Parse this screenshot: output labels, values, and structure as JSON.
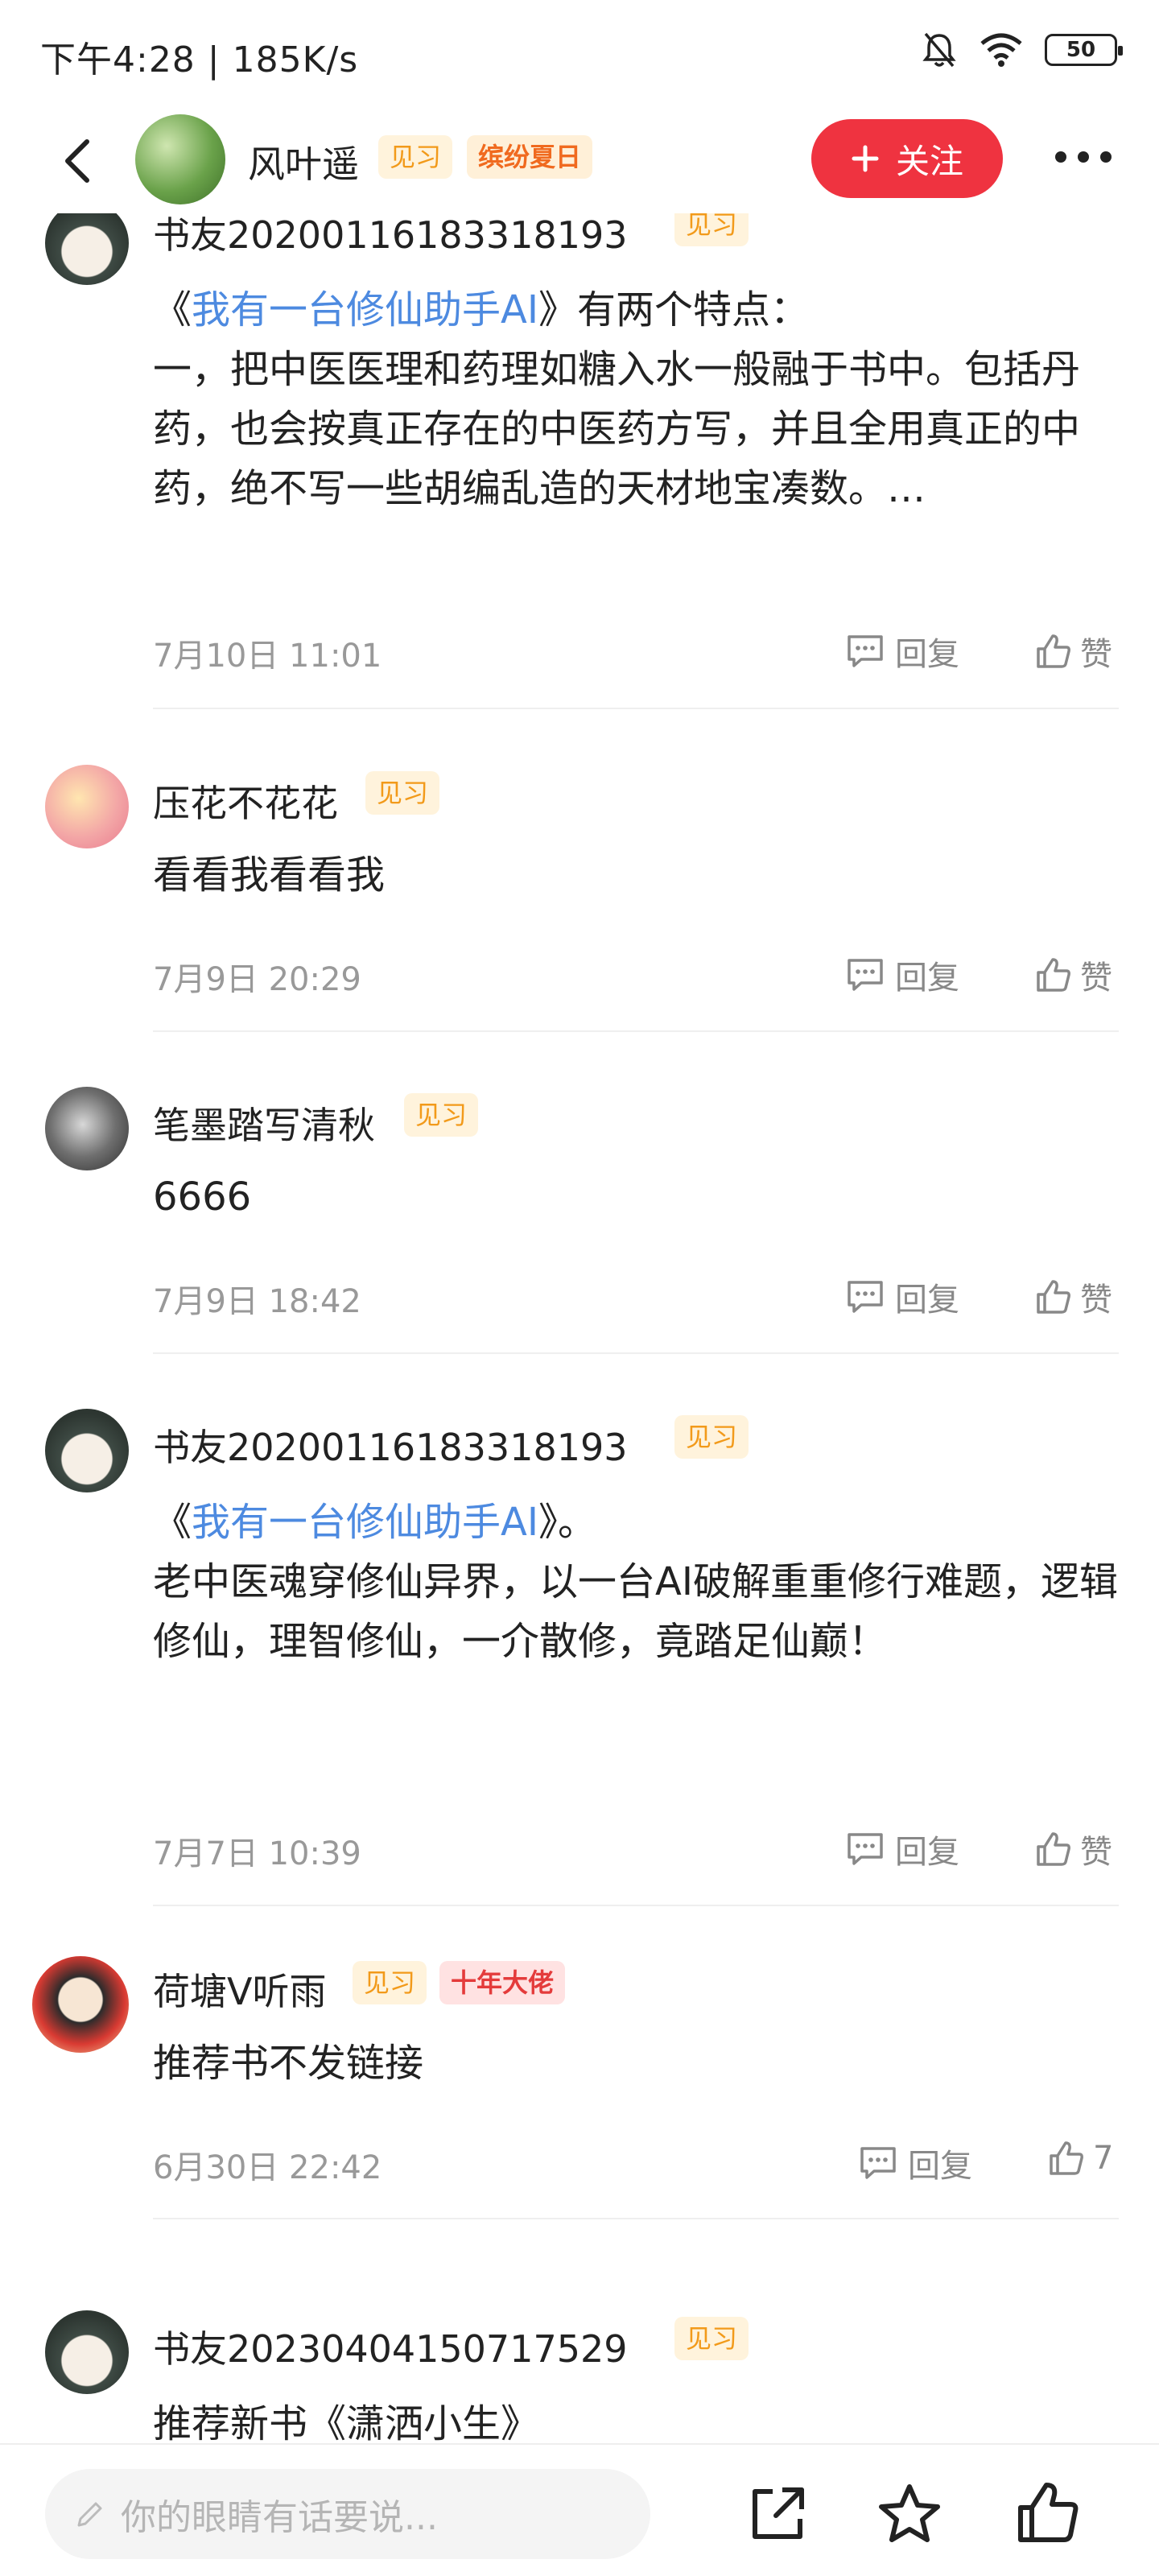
{
  "status_bar": {
    "time_speed": "下午4:28 | 185K/s",
    "battery": "50",
    "icons": [
      "mute-bell-icon",
      "wifi-icon",
      "battery-icon"
    ]
  },
  "header": {
    "name": "风叶遥",
    "badge_learn": "见习",
    "badge_event": "缤纷夏日",
    "follow_label": "关注",
    "icons": [
      "back-icon",
      "more-icon",
      "plus-icon"
    ]
  },
  "comments": [
    {
      "user": "书友20200116183318193",
      "badge": "见习",
      "open_quote": "《",
      "book": "我有一台修仙助手AI",
      "rest": "》有两个特点：\n一，把中医医理和药理如糖入水一般融于书中。包括丹药，也会按真正存在的中医药方写，并且全用真正的中药，绝不写一些胡编乱造的天材地宝凑数。…",
      "time": "7月10日 11:01",
      "reply": "回复",
      "like": "赞"
    },
    {
      "user": "压花不花花",
      "badge": "见习",
      "text": "看看我看看我",
      "time": "7月9日 20:29",
      "reply": "回复",
      "like": "赞"
    },
    {
      "user": "笔墨踏写清秋",
      "badge": "见习",
      "text": "6666",
      "time": "7月9日 18:42",
      "reply": "回复",
      "like": "赞"
    },
    {
      "user": "书友20200116183318193",
      "badge": "见习",
      "open_quote": "《",
      "book": "我有一台修仙助手AI",
      "rest": "》。\n老中医魂穿修仙异界，以一台AI破解重重修行难题，逻辑修仙，理智修仙，一介散修，竟踏足仙巅！",
      "time": "7月7日 10:39",
      "reply": "回复",
      "like": "赞"
    },
    {
      "user": "荷塘V听雨",
      "badge": "见习",
      "badge2": "十年大佬",
      "text": "推荐书不发链接",
      "time": "6月30日 22:42",
      "reply": "回复",
      "like": "7"
    },
    {
      "user": "书友20230404150717529",
      "badge": "见习",
      "text": "推荐新书《潇洒小生》"
    }
  ],
  "bottom_bar": {
    "input_placeholder": "你的眼睛有话要说...",
    "icons": [
      "pencil-icon",
      "share-icon",
      "star-icon",
      "thumb-up-icon"
    ]
  }
}
